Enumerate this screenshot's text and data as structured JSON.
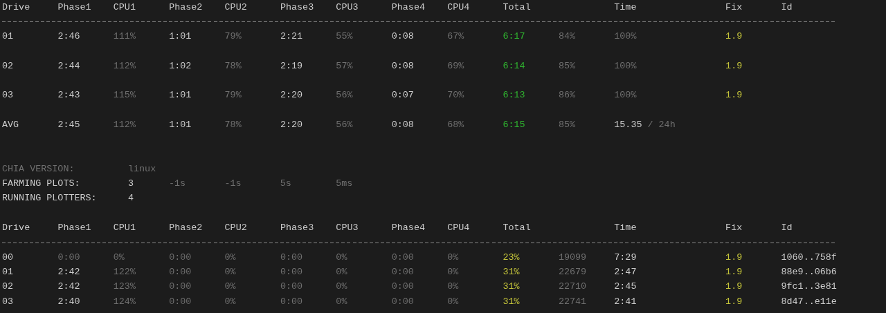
{
  "tables": [
    {
      "spaced": true,
      "columns": [
        {
          "label": "Drive"
        },
        {
          "label": "Phase1"
        },
        {
          "label": "CPU1"
        },
        {
          "label": "Phase2"
        },
        {
          "label": "CPU2"
        },
        {
          "label": "Phase3"
        },
        {
          "label": "CPU3"
        },
        {
          "label": "Phase4"
        },
        {
          "label": "CPU4"
        },
        {
          "label": "Total"
        },
        {
          "kind": "unlabeled"
        },
        {
          "label": "Time"
        },
        {
          "label": "Fix"
        },
        {
          "label": "Id"
        }
      ],
      "rows": [
        [
          {
            "text": "01",
            "color": "#cccccc"
          },
          {
            "text": "2:46",
            "color": "#cccccc"
          },
          {
            "text": "111%",
            "color": "#6f6f6f"
          },
          {
            "text": "1:01",
            "color": "#cccccc"
          },
          {
            "text": "79%",
            "color": "#6f6f6f"
          },
          {
            "text": "2:21",
            "color": "#cccccc"
          },
          {
            "text": "55%",
            "color": "#6f6f6f"
          },
          {
            "text": "0:08",
            "color": "#cccccc"
          },
          {
            "text": "67%",
            "color": "#6f6f6f"
          },
          {
            "text": "6:17",
            "color": "#2fb52f"
          },
          {
            "text": "84%",
            "color": "#6f6f6f"
          },
          {
            "text": "100%",
            "color": "#6f6f6f"
          },
          {
            "text": "1.9",
            "color": "#c5c53a"
          }
        ],
        [
          {
            "text": "02",
            "color": "#cccccc"
          },
          {
            "text": "2:44",
            "color": "#cccccc"
          },
          {
            "text": "112%",
            "color": "#6f6f6f"
          },
          {
            "text": "1:02",
            "color": "#cccccc"
          },
          {
            "text": "78%",
            "color": "#6f6f6f"
          },
          {
            "text": "2:19",
            "color": "#cccccc"
          },
          {
            "text": "57%",
            "color": "#6f6f6f"
          },
          {
            "text": "0:08",
            "color": "#cccccc"
          },
          {
            "text": "69%",
            "color": "#6f6f6f"
          },
          {
            "text": "6:14",
            "color": "#2fb52f"
          },
          {
            "text": "85%",
            "color": "#6f6f6f"
          },
          {
            "text": "100%",
            "color": "#6f6f6f"
          },
          {
            "text": "1.9",
            "color": "#c5c53a"
          }
        ],
        [
          {
            "text": "03",
            "color": "#cccccc"
          },
          {
            "text": "2:43",
            "color": "#cccccc"
          },
          {
            "text": "115%",
            "color": "#6f6f6f"
          },
          {
            "text": "1:01",
            "color": "#cccccc"
          },
          {
            "text": "79%",
            "color": "#6f6f6f"
          },
          {
            "text": "2:20",
            "color": "#cccccc"
          },
          {
            "text": "56%",
            "color": "#6f6f6f"
          },
          {
            "text": "0:07",
            "color": "#cccccc"
          },
          {
            "text": "70%",
            "color": "#6f6f6f"
          },
          {
            "text": "6:13",
            "color": "#2fb52f"
          },
          {
            "text": "86%",
            "color": "#6f6f6f"
          },
          {
            "text": "100%",
            "color": "#6f6f6f"
          },
          {
            "text": "1.9",
            "color": "#c5c53a"
          }
        ],
        [
          {
            "text": "AVG",
            "color": "#cccccc"
          },
          {
            "text": "2:45",
            "color": "#cccccc"
          },
          {
            "text": "112%",
            "color": "#6f6f6f"
          },
          {
            "text": "1:01",
            "color": "#cccccc"
          },
          {
            "text": "78%",
            "color": "#6f6f6f"
          },
          {
            "text": "2:20",
            "color": "#cccccc"
          },
          {
            "text": "56%",
            "color": "#6f6f6f"
          },
          {
            "text": "0:08",
            "color": "#cccccc"
          },
          {
            "text": "68%",
            "color": "#6f6f6f"
          },
          {
            "text": "6:15",
            "color": "#2fb52f"
          },
          {
            "text": "85%",
            "color": "#6f6f6f"
          },
          {
            "parts": [
              {
                "text": "15.35",
                "color": "#cccccc"
              },
              {
                "text": "/ 24h",
                "color": "#6f6f6f"
              }
            ]
          }
        ]
      ]
    },
    {
      "info": [
        {
          "label": "CHIA VERSION:",
          "value": "linux",
          "color": "#6f6f6f"
        },
        {
          "label": "FARMING PLOTS:",
          "value": "3",
          "color": "#cccccc",
          "timings": [
            "-1s",
            "-1s",
            "5s",
            "5ms"
          ]
        },
        {
          "label": "RUNNING PLOTTERS:",
          "value": "4",
          "color": "#cccccc"
        }
      ]
    },
    {
      "spaced": false,
      "columns": [
        {
          "label": "Drive"
        },
        {
          "label": "Phase1"
        },
        {
          "label": "CPU1"
        },
        {
          "label": "Phase2"
        },
        {
          "label": "CPU2"
        },
        {
          "label": "Phase3"
        },
        {
          "label": "CPU3"
        },
        {
          "label": "Phase4"
        },
        {
          "label": "CPU4"
        },
        {
          "label": "Total"
        },
        {
          "kind": "unlabeled"
        },
        {
          "label": "Time"
        },
        {
          "label": "Fix"
        },
        {
          "label": "Id"
        }
      ],
      "rows": [
        [
          {
            "text": "00",
            "color": "#cccccc"
          },
          {
            "text": "0:00",
            "color": "#6f6f6f"
          },
          {
            "text": "0%",
            "color": "#6f6f6f"
          },
          {
            "text": "0:00",
            "color": "#6f6f6f"
          },
          {
            "text": "0%",
            "color": "#6f6f6f"
          },
          {
            "text": "0:00",
            "color": "#6f6f6f"
          },
          {
            "text": "0%",
            "color": "#6f6f6f"
          },
          {
            "text": "0:00",
            "color": "#6f6f6f"
          },
          {
            "text": "0%",
            "color": "#6f6f6f"
          },
          {
            "text": "23%",
            "color": "#c5c53a"
          },
          {
            "text": "19099",
            "color": "#6f6f6f"
          },
          {
            "text": "7:29",
            "color": "#cccccc"
          },
          {
            "text": "1.9",
            "color": "#c5c53a"
          },
          {
            "text": "1060..758f",
            "color": "#cccccc"
          }
        ],
        [
          {
            "text": "01",
            "color": "#cccccc"
          },
          {
            "text": "2:42",
            "color": "#cccccc"
          },
          {
            "text": "122%",
            "color": "#6f6f6f"
          },
          {
            "text": "0:00",
            "color": "#6f6f6f"
          },
          {
            "text": "0%",
            "color": "#6f6f6f"
          },
          {
            "text": "0:00",
            "color": "#6f6f6f"
          },
          {
            "text": "0%",
            "color": "#6f6f6f"
          },
          {
            "text": "0:00",
            "color": "#6f6f6f"
          },
          {
            "text": "0%",
            "color": "#6f6f6f"
          },
          {
            "text": "31%",
            "color": "#c5c53a"
          },
          {
            "text": "22679",
            "color": "#6f6f6f"
          },
          {
            "text": "2:47",
            "color": "#cccccc"
          },
          {
            "text": "1.9",
            "color": "#c5c53a"
          },
          {
            "text": "88e9..06b6",
            "color": "#cccccc"
          }
        ],
        [
          {
            "text": "02",
            "color": "#cccccc"
          },
          {
            "text": "2:42",
            "color": "#cccccc"
          },
          {
            "text": "123%",
            "color": "#6f6f6f"
          },
          {
            "text": "0:00",
            "color": "#6f6f6f"
          },
          {
            "text": "0%",
            "color": "#6f6f6f"
          },
          {
            "text": "0:00",
            "color": "#6f6f6f"
          },
          {
            "text": "0%",
            "color": "#6f6f6f"
          },
          {
            "text": "0:00",
            "color": "#6f6f6f"
          },
          {
            "text": "0%",
            "color": "#6f6f6f"
          },
          {
            "text": "31%",
            "color": "#c5c53a"
          },
          {
            "text": "22710",
            "color": "#6f6f6f"
          },
          {
            "text": "2:45",
            "color": "#cccccc"
          },
          {
            "text": "1.9",
            "color": "#c5c53a"
          },
          {
            "text": "9fc1..3e81",
            "color": "#cccccc"
          }
        ],
        [
          {
            "text": "03",
            "color": "#cccccc"
          },
          {
            "text": "2:40",
            "color": "#cccccc"
          },
          {
            "text": "124%",
            "color": "#6f6f6f"
          },
          {
            "text": "0:00",
            "color": "#6f6f6f"
          },
          {
            "text": "0%",
            "color": "#6f6f6f"
          },
          {
            "text": "0:00",
            "color": "#6f6f6f"
          },
          {
            "text": "0%",
            "color": "#6f6f6f"
          },
          {
            "text": "0:00",
            "color": "#6f6f6f"
          },
          {
            "text": "0%",
            "color": "#6f6f6f"
          },
          {
            "text": "31%",
            "color": "#c5c53a"
          },
          {
            "text": "22741",
            "color": "#6f6f6f"
          },
          {
            "text": "2:41",
            "color": "#cccccc"
          },
          {
            "text": "1.9",
            "color": "#c5c53a"
          },
          {
            "text": "8d47..e11e",
            "color": "#cccccc"
          }
        ]
      ]
    }
  ]
}
